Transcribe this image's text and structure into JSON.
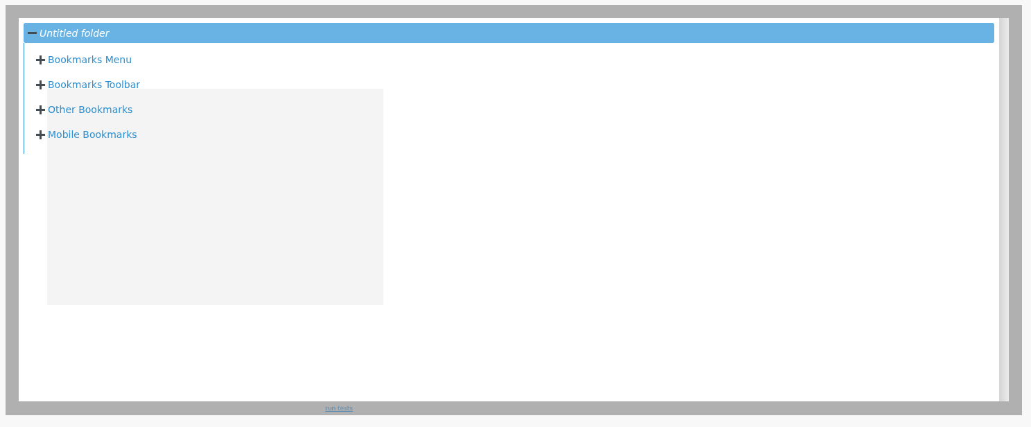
{
  "tree": {
    "label": "Untitled folder",
    "expanded": true,
    "children": [
      {
        "label": "Bookmarks Menu",
        "expanded": false
      },
      {
        "label": "Bookmarks Toolbar",
        "expanded": false
      },
      {
        "label": "Other Bookmarks",
        "expanded": false
      },
      {
        "label": "Mobile Bookmarks",
        "expanded": false
      }
    ]
  },
  "footer_link": "run tests"
}
